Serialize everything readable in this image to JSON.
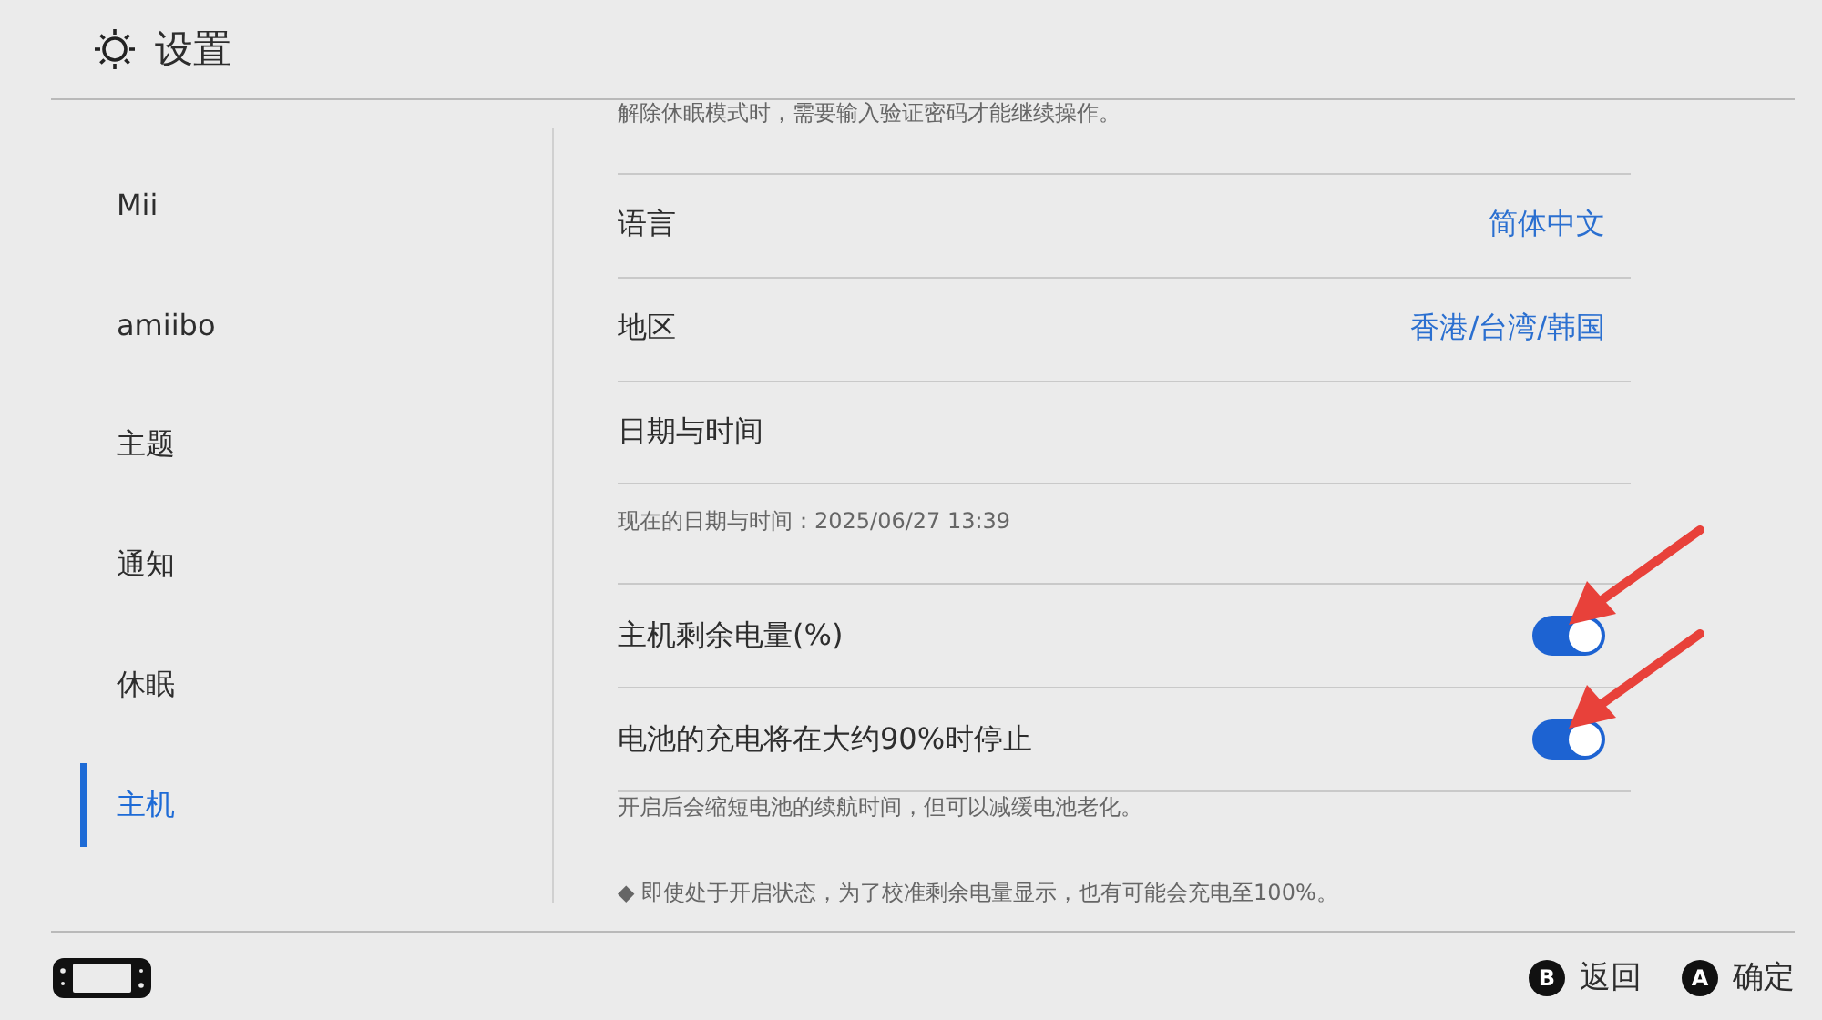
{
  "header": {
    "title": "设置"
  },
  "sidebar": {
    "items": [
      {
        "label": "Mii",
        "selected": false
      },
      {
        "label": "amiibo",
        "selected": false
      },
      {
        "label": "主题",
        "selected": false
      },
      {
        "label": "通知",
        "selected": false
      },
      {
        "label": "休眠",
        "selected": false
      },
      {
        "label": "主机",
        "selected": true
      }
    ]
  },
  "content": {
    "items": [
      {
        "kind": "note",
        "text": "解除休眠模式时，需要输入验证密码才能继续操作。"
      },
      {
        "kind": "value",
        "label": "语言",
        "value": "简体中文"
      },
      {
        "kind": "value",
        "label": "地区",
        "value": "香港/台湾/韩国"
      },
      {
        "kind": "plain",
        "label": "日期与时间"
      },
      {
        "kind": "note",
        "text": "现在的日期与时间：2025/06/27 13:39"
      },
      {
        "kind": "toggle",
        "label": "主机剩余电量(%)",
        "on": true
      },
      {
        "kind": "toggle",
        "label": "电池的充电将在大约90%时停止",
        "on": true
      },
      {
        "kind": "note",
        "text": "开启后会缩短电池的续航时间，但可以减缓电池老化。"
      },
      {
        "kind": "note",
        "text": "◆ 即使处于开启状态，为了校准剩余电量显示，也有可能会充电至100%。"
      }
    ]
  },
  "footer": {
    "buttons": [
      {
        "key": "B",
        "label": "返回"
      },
      {
        "key": "A",
        "label": "确定"
      }
    ]
  }
}
